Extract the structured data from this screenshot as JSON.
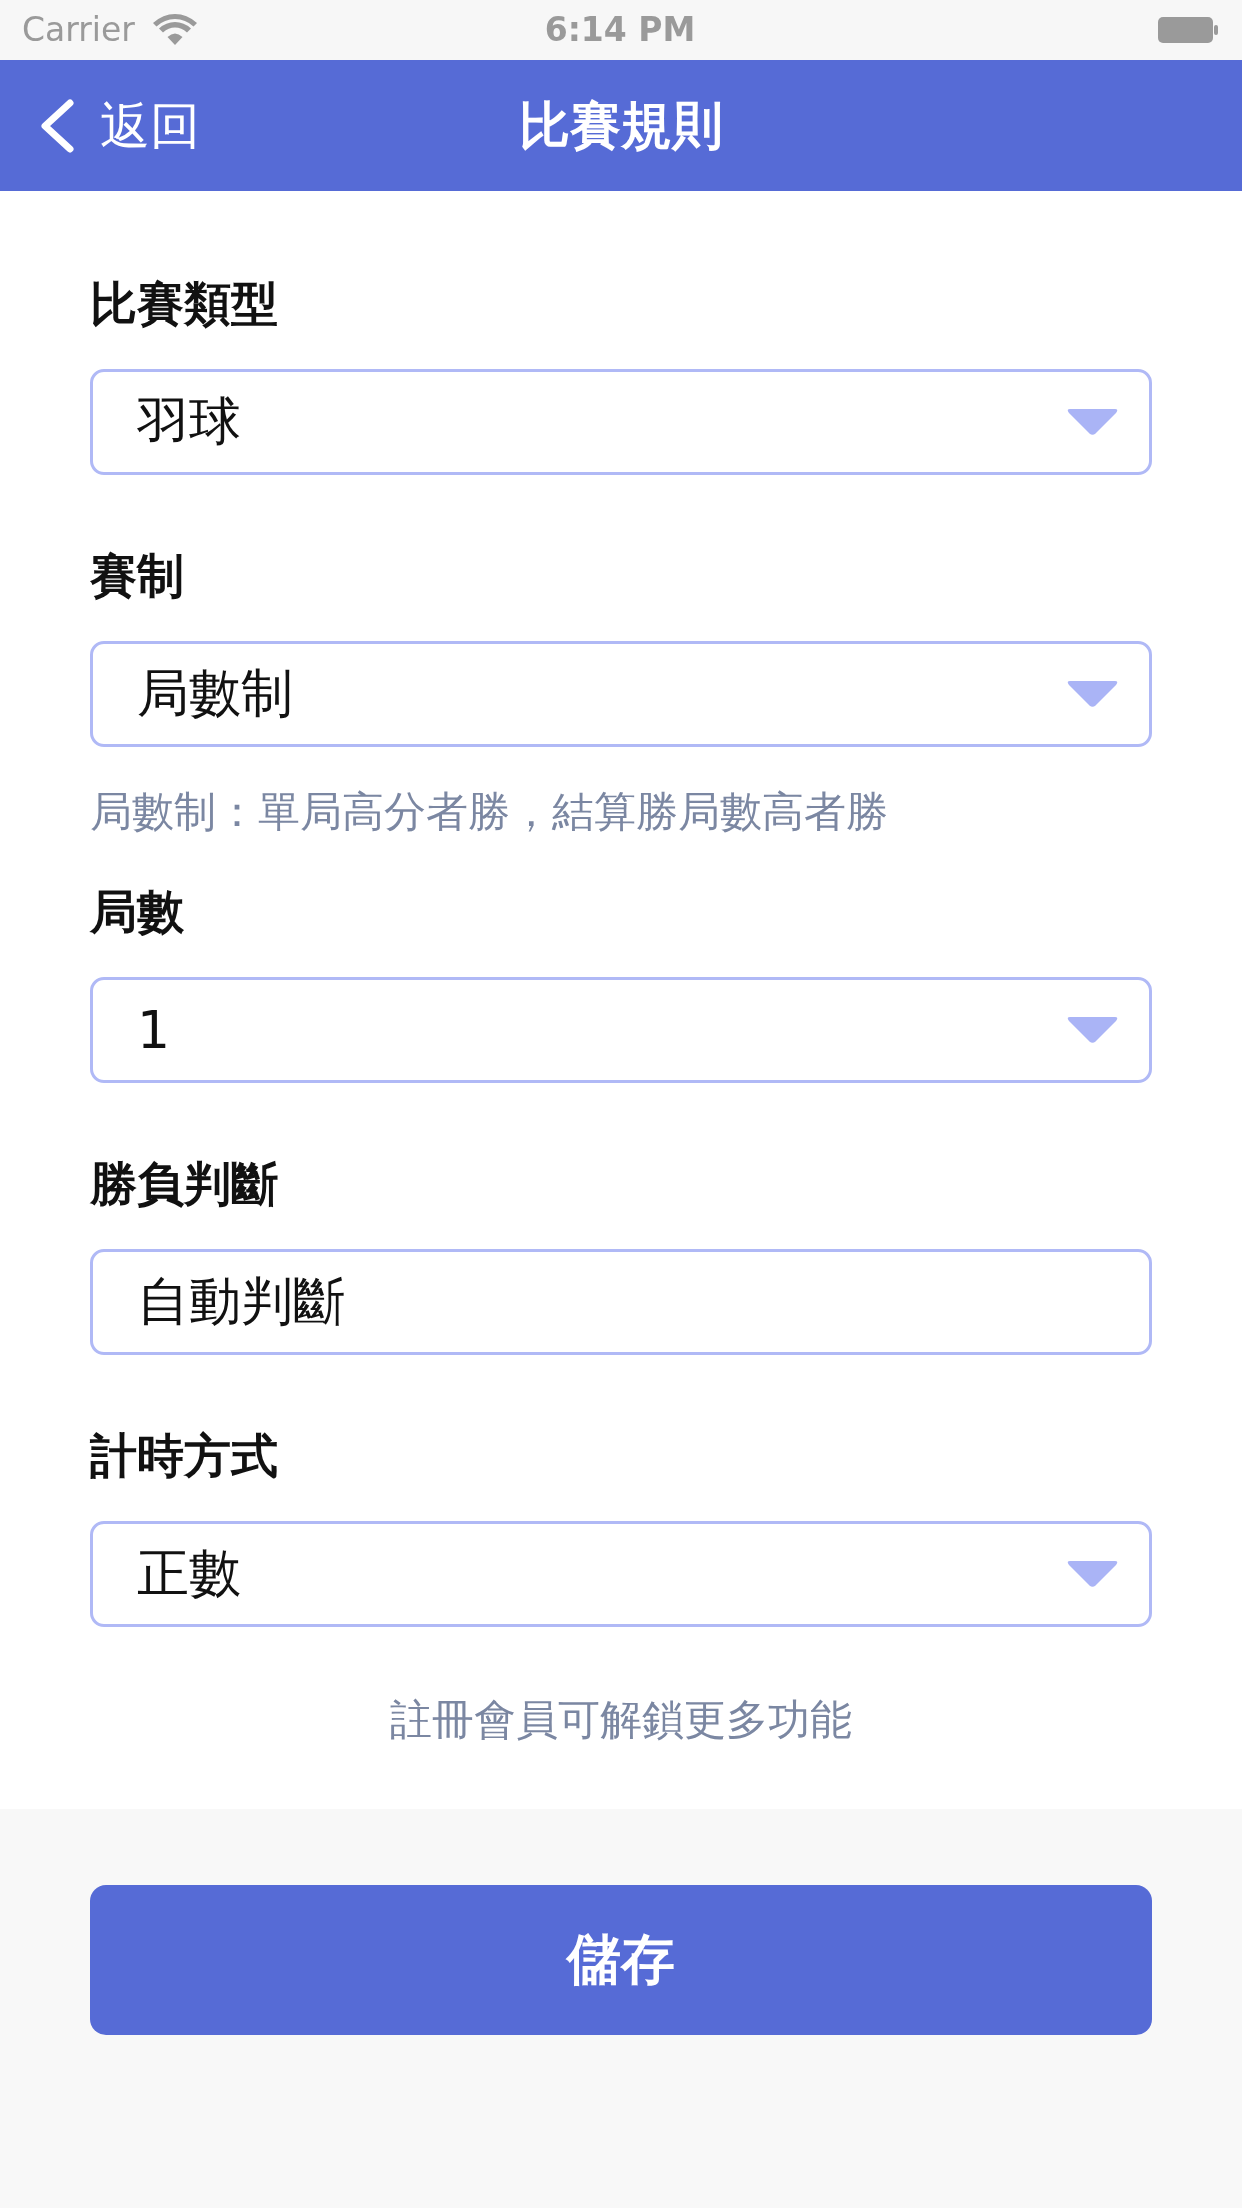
{
  "status_bar": {
    "carrier": "Carrier",
    "time": "6:14 PM"
  },
  "nav_bar": {
    "back_label": "返回",
    "title": "比賽規則"
  },
  "form": {
    "fields": [
      {
        "label": "比賽類型",
        "value": "羽球",
        "kind": "dropdown"
      },
      {
        "label": "賽制",
        "value": "局數制",
        "kind": "dropdown",
        "hint": "局數制：單局高分者勝，結算勝局數高者勝"
      },
      {
        "label": "局數",
        "value": "1",
        "kind": "dropdown"
      },
      {
        "label": "勝負判斷",
        "value": "自動判斷",
        "kind": "text"
      },
      {
        "label": "計時方式",
        "value": "正數",
        "kind": "dropdown"
      }
    ],
    "note": "註冊會員可解鎖更多功能"
  },
  "save_button": {
    "label": "儲存"
  }
}
